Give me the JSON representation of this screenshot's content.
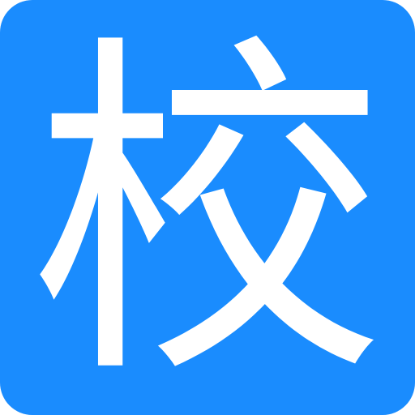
{
  "icon": {
    "glyph": "校",
    "background_color": "#1a8cfe",
    "glyph_color": "#ffffff"
  }
}
